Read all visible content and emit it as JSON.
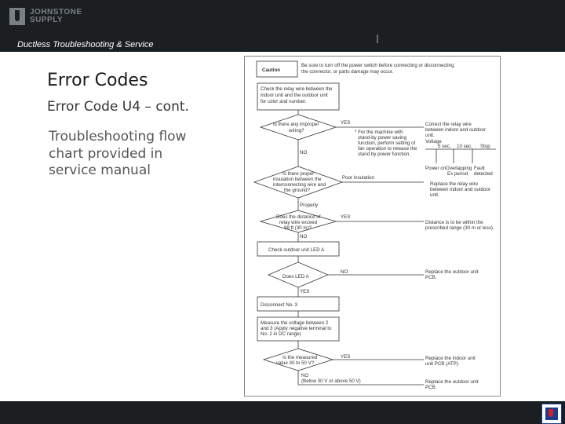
{
  "header": {
    "brand_line1": "JOHNSTONE",
    "brand_line2": "SUPPLY",
    "subtitle": "Ductless Troubleshooting & Service"
  },
  "slide": {
    "title": "Error Codes",
    "subtitle": "Error Code U4 – cont.",
    "bullet": "Troubleshooting flow chart provided in service manual"
  },
  "flowchart": {
    "caution_label": "Caution",
    "caution_line1": "Be sure to turn off the power switch before connecting or disconnecting",
    "caution_line2": "the connector, or parts damage may occur.",
    "box1_line1": "Check the relay wire between the",
    "box1_line2": "indoor unit and the outdoor unit",
    "box1_line3": "for color and number.",
    "d1_line1": "Is there any improper",
    "d1_line2": "wiring?",
    "yes": "YES",
    "no": "NO",
    "note1_line1": "* For the machine with",
    "note1_line2": "stand-by power saving",
    "note1_line3": "function, perform setting of",
    "note1_line4": "fan operation to release the",
    "note1_line5": "stand by power function.",
    "correct_line1": "Correct the relay wire",
    "correct_line2": "between indoor and outdoor",
    "correct_line3": "unit.",
    "voltage": "Voltage",
    "v_5sec": "5 sec.",
    "v_10sec": "10 sec.",
    "v_stop": "Stop",
    "v_power_on": "Power on",
    "v_overlap": "Overlapping",
    "v_ex_period": "Ex period",
    "v_fault": "Fault",
    "v_detected": "detected",
    "d2_line1": "Is there proper",
    "d2_line2": "insulation between the",
    "d2_line3": "interconnecting wire and",
    "d2_line4": "the ground?",
    "poor_insulation": "Poor insulation",
    "replace_relay_line1": "Replace the relay wire",
    "replace_relay_line2": "between indoor and outdoor",
    "replace_relay_line3": "unit.",
    "properly": "Properly",
    "d3_line1": "Does the distance of",
    "d3_line2": "relay wire exceed",
    "d3_line3": "98 ft (30 m)?",
    "distance_line1": "Distance is to be within the",
    "distance_line2": "prescribed range (30 m or less).",
    "check_led": "Check outdoor unit LED A",
    "d4_line1": "Does LED A",
    "d4_line2": "blink?",
    "pcb_outdoor_line1": "Replace the outdoor unit",
    "pcb_outdoor_line2": "PCB.",
    "disconnect": "Disconnect No. 3",
    "measure_line1": "Measure the voltage between 2",
    "measure_line2": "and 3 (Apply negative terminal to",
    "measure_line3": "No. 2 in DC range)",
    "d5_line1": "Is the measured",
    "d5_line2": "value 30 to 50 V?",
    "indoor_pcb_line1": "Replace the indoor unit",
    "indoor_pcb_line2": "unit PCB (ATP).",
    "no_note": "(Below 30 V or above 50 V)",
    "outdoor_last_line1": "Replace the outdoor unit",
    "outdoor_last_line2": "PCB."
  }
}
